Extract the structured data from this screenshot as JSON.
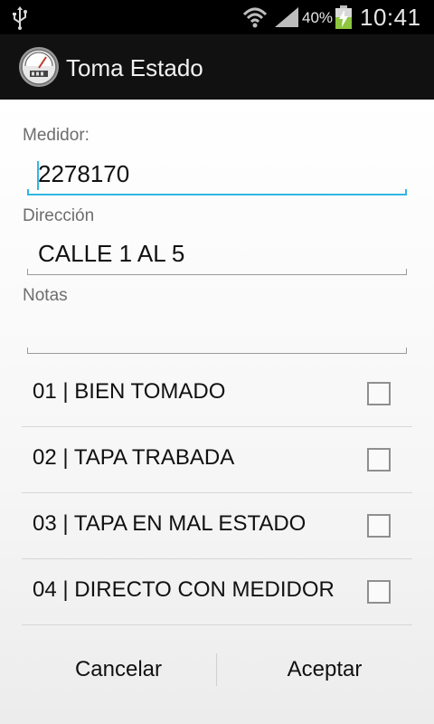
{
  "status_bar": {
    "battery_percent": "40%",
    "time": "10:41",
    "icons": [
      "usb-icon",
      "wifi-icon",
      "signal-icon",
      "battery-charging-icon"
    ]
  },
  "action_bar": {
    "title": "Toma Estado",
    "icon": "meter-gauge-icon"
  },
  "form": {
    "medidor_label": "Medidor:",
    "medidor_value": "2278170",
    "direccion_label": "Dirección",
    "direccion_value": "CALLE 1 AL 5",
    "notas_label": "Notas",
    "notas_value": ""
  },
  "options": [
    {
      "label": "01 | BIEN TOMADO",
      "checked": false
    },
    {
      "label": "02 | TAPA TRABADA",
      "checked": false
    },
    {
      "label": "03 | TAPA EN MAL ESTADO",
      "checked": false
    },
    {
      "label": "04 | DIRECTO CON MEDIDOR",
      "checked": false
    }
  ],
  "buttons": {
    "cancel": "Cancelar",
    "accept": "Aceptar"
  },
  "colors": {
    "accent": "#33b5e5",
    "status_bar": "#000000",
    "action_bar": "#111111"
  }
}
